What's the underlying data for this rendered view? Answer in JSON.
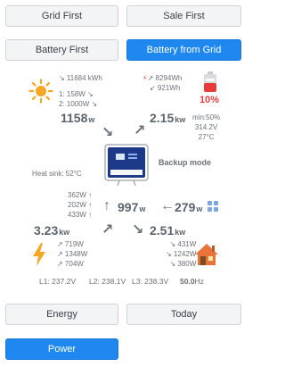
{
  "buttons": {
    "grid_first": "Grid First",
    "sale_first": "Sale First",
    "battery_first": "Battery First",
    "battery_from_grid": "Battery from Grid",
    "energy": "Energy",
    "today": "Today",
    "power": "Power"
  },
  "solar": {
    "total": "↘ 11684 kWh",
    "pv1": "1: 158W ↘",
    "pv2": "2: 1000W ↘",
    "power_value": "1158",
    "power_unit": "w",
    "arrow": "↘"
  },
  "battery": {
    "charge": "↗ 8294Wh",
    "discharge": "↙ 921Wh",
    "soc": "10%",
    "power_value": "2.15",
    "power_unit": "kw",
    "arrow": "↗",
    "min": "min:50%",
    "voltage": "314.2V",
    "temp": "27°C"
  },
  "inverter": {
    "mode": "Backup mode",
    "heat_sink": "Heat sink: 52°C"
  },
  "center": {
    "phases": [
      "362W ↑",
      "202W ↑",
      "433W ↑"
    ],
    "power_arrow": "↑",
    "power_value": "997",
    "power_unit": "w"
  },
  "grid_ct": {
    "arrow": "←",
    "power_value": "279",
    "power_unit": "w"
  },
  "generator": {
    "power_value": "3.23",
    "power_unit": "kw",
    "arrow": "↗",
    "phases": [
      "↗ 719W",
      "↗ 1348W",
      "↗ 704W"
    ]
  },
  "home": {
    "power_value": "2.51",
    "power_unit": "kw",
    "arrow": "↘",
    "phases": [
      "↘ 431W",
      "↘ 1242W",
      "↘ 380W"
    ]
  },
  "grid": {
    "l1": "L1: 237.2V",
    "l2": "L2: 238.1V",
    "l3": "L3: 238.3V",
    "freq": "50.0",
    "freq_unit": "Hz"
  },
  "colors": {
    "primary": "#1e88f0",
    "sun": "#f5a623",
    "battery_red": "#e83c3c",
    "house": "#e8743b",
    "inverter_blue": "#1d3a8a"
  }
}
